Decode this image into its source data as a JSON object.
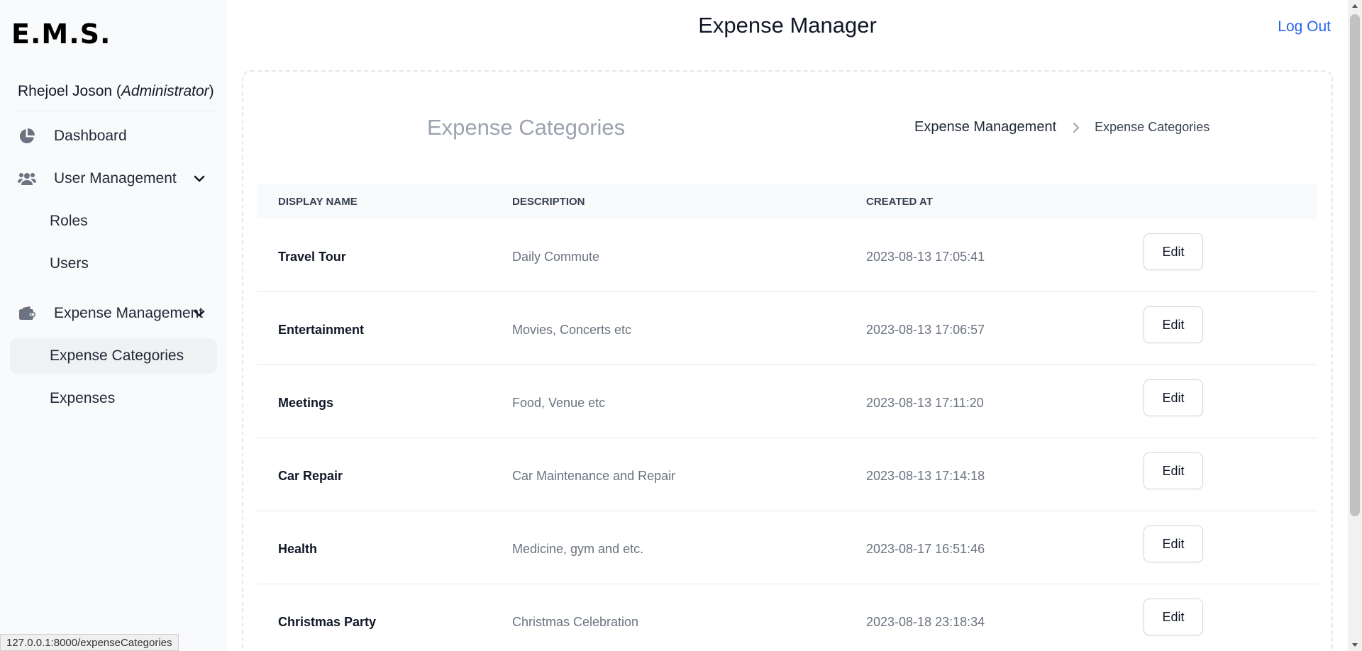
{
  "app": {
    "logo": "E.M.S.",
    "title": "Expense Manager",
    "logout": "Log Out"
  },
  "user": {
    "name": "Rhejoel Joson",
    "role": "Administrator"
  },
  "sidebar": {
    "dashboard": "Dashboard",
    "user_management": "User Management",
    "roles": "Roles",
    "users": "Users",
    "expense_management": "Expense Management",
    "expense_categories": "Expense Categories",
    "expenses": "Expenses"
  },
  "page": {
    "title": "Expense Categories",
    "breadcrumb": [
      "Expense Management",
      "Expense Categories"
    ]
  },
  "table": {
    "headers": [
      "Display Name",
      "Description",
      "Created At"
    ],
    "edit_label": "Edit",
    "rows": [
      {
        "name": "Travel Tour",
        "description": "Daily Commute",
        "created_at": "2023-08-13 17:05:41"
      },
      {
        "name": "Entertainment",
        "description": "Movies, Concerts etc",
        "created_at": "2023-08-13 17:06:57"
      },
      {
        "name": "Meetings",
        "description": "Food, Venue etc",
        "created_at": "2023-08-13 17:11:20"
      },
      {
        "name": "Car Repair",
        "description": "Car Maintenance and Repair",
        "created_at": "2023-08-13 17:14:18"
      },
      {
        "name": "Health",
        "description": "Medicine, gym and etc.",
        "created_at": "2023-08-17 16:51:46"
      },
      {
        "name": "Christmas Party",
        "description": "Christmas Celebration",
        "created_at": "2023-08-18 23:18:34"
      }
    ]
  },
  "statusbar": {
    "url": "127.0.0.1:8000/expenseCategories"
  },
  "colors": {
    "accent": "#2563eb",
    "sidebar_bg": "#f9fafb",
    "muted_text": "#6b7280"
  },
  "icons": {
    "dashboard": "pie-chart-icon",
    "user_management": "users-icon",
    "expense_management": "wallet-icon",
    "expand": "chevron-down-icon",
    "breadcrumb_separator": "chevron-right-icon"
  }
}
